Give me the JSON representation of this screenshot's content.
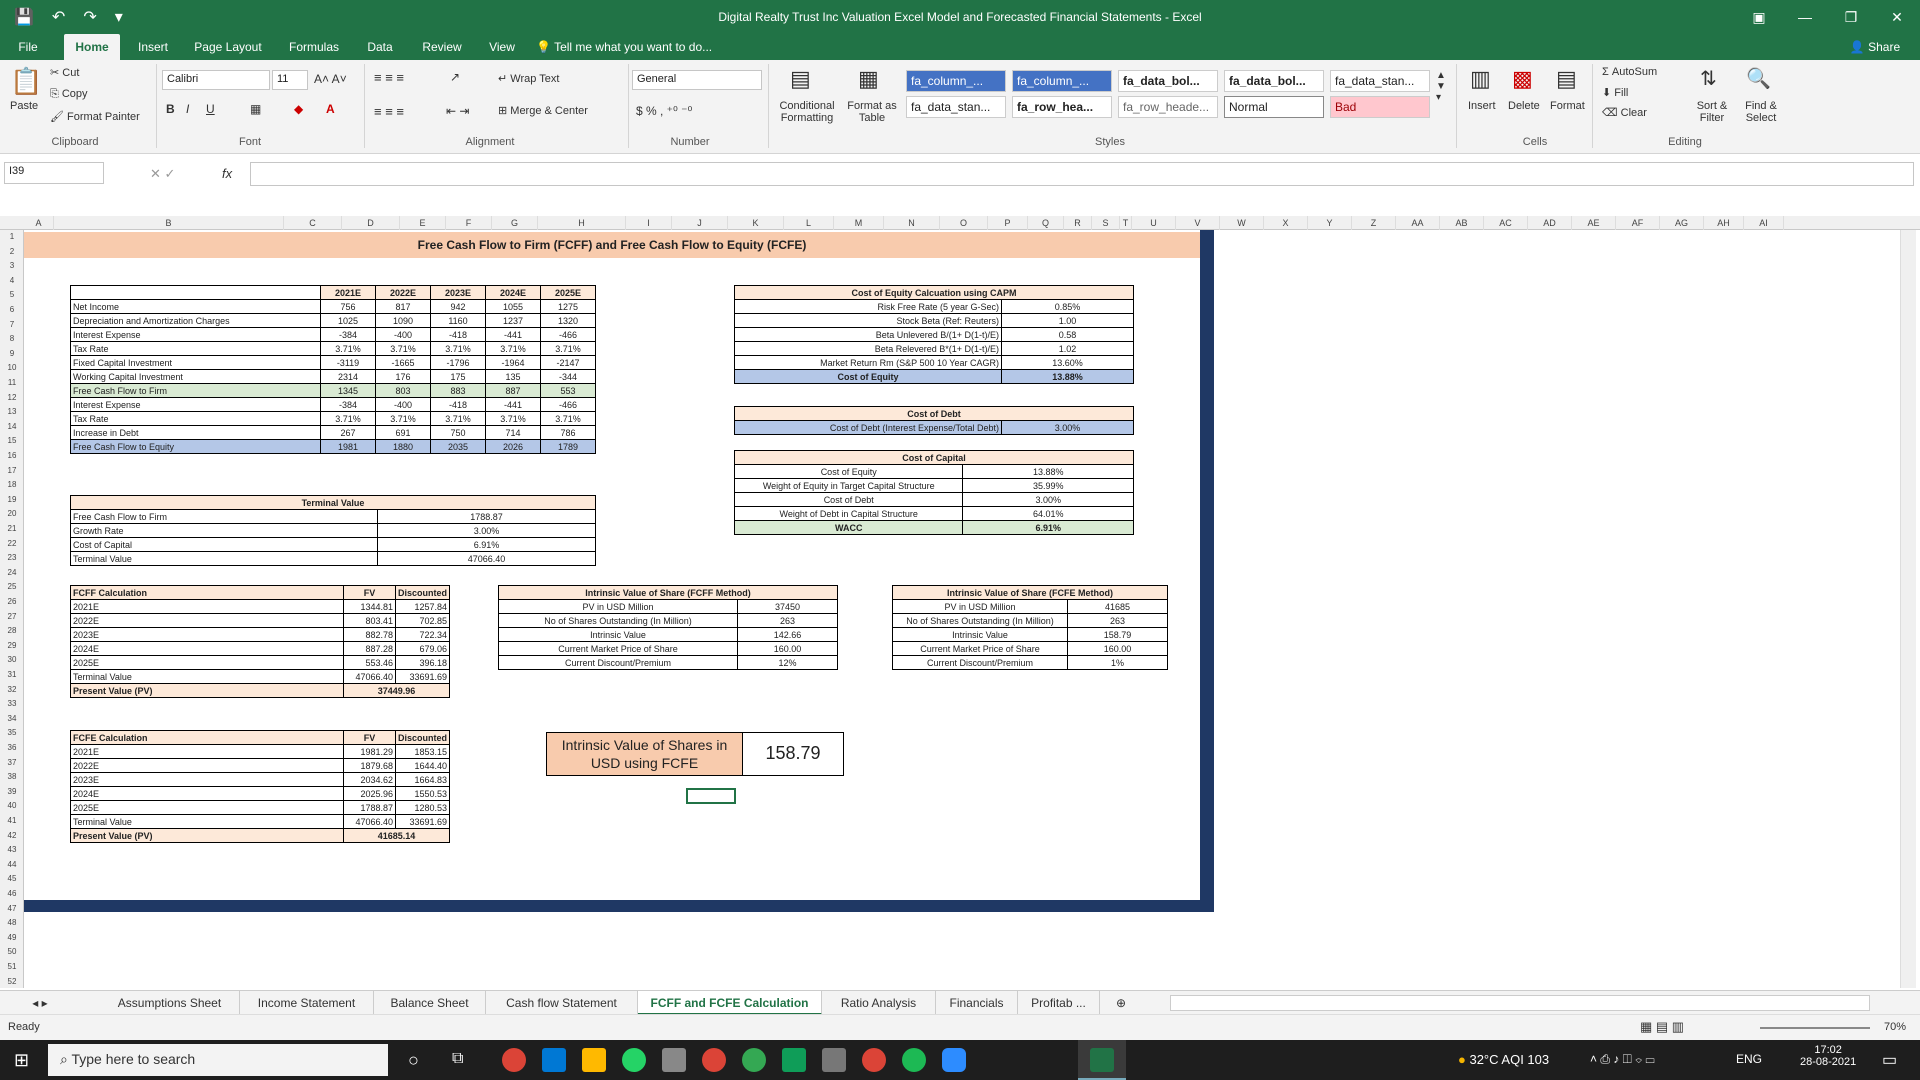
{
  "window": {
    "title": "Digital Realty Trust Inc Valuation Excel Model and Forecasted Financial Statements - Excel",
    "share": "Share"
  },
  "menu": {
    "tabs": [
      "File",
      "Home",
      "Insert",
      "Page Layout",
      "Formulas",
      "Data",
      "Review",
      "View"
    ],
    "tell": "Tell me what you want to do..."
  },
  "ribbon": {
    "clipboard": {
      "paste": "Paste",
      "cut": "Cut",
      "copy": "Copy",
      "painter": "Format Painter",
      "label": "Clipboard"
    },
    "font": {
      "name": "Calibri",
      "size": "11",
      "label": "Font"
    },
    "alignment": {
      "wrap": "Wrap Text",
      "merge": "Merge & Center",
      "label": "Alignment"
    },
    "number": {
      "format": "General",
      "label": "Number"
    },
    "styles": {
      "cond": "Conditional Formatting",
      "table": "Format as Table",
      "label": "Styles",
      "cells": [
        "fa_column_...",
        "fa_column_...",
        "fa_data_bol...",
        "fa_data_bol...",
        "fa_data_stan...",
        "fa_data_stan...",
        "fa_row_hea...",
        "fa_row_heade...",
        "Normal",
        "Bad"
      ]
    },
    "cells": {
      "insert": "Insert",
      "delete": "Delete",
      "format": "Format",
      "label": "Cells"
    },
    "editing": {
      "autosum": "AutoSum",
      "fill": "Fill",
      "clear": "Clear",
      "sort": "Sort & Filter",
      "find": "Find & Select",
      "label": "Editing"
    }
  },
  "formula": {
    "namebox": "I39",
    "fx": "fx",
    "value": ""
  },
  "columns": [
    "A",
    "B",
    "C",
    "D",
    "E",
    "F",
    "G",
    "H",
    "I",
    "J",
    "K",
    "L",
    "M",
    "N",
    "O",
    "P",
    "Q",
    "R",
    "S",
    "T",
    "U",
    "V",
    "W",
    "X",
    "Y",
    "Z",
    "AA",
    "AB",
    "AC",
    "AD",
    "AE",
    "AF",
    "AG",
    "AH",
    "AI"
  ],
  "rows": [
    "1",
    "2",
    "3",
    "4",
    "5",
    "6",
    "7",
    "8",
    "9",
    "10",
    "11",
    "12",
    "13",
    "14",
    "15",
    "16",
    "17",
    "18",
    "19",
    "20",
    "21",
    "22",
    "23",
    "24",
    "25",
    "26",
    "27",
    "28",
    "29",
    "30",
    "31",
    "32",
    "33",
    "34",
    "35",
    "36",
    "37",
    "38",
    "39",
    "40",
    "41",
    "42",
    "43",
    "44",
    "45",
    "46",
    "47",
    "48",
    "49",
    "50",
    "51",
    "52"
  ],
  "model": {
    "banner": "Free Cash Flow to Firm (FCFF) and Free Cash Flow to Equity (FCFE)",
    "fcf": {
      "headers": [
        "",
        "2021E",
        "2022E",
        "2023E",
        "2024E",
        "2025E"
      ],
      "rows": [
        [
          "Net Income",
          "756",
          "817",
          "942",
          "1055",
          "1275"
        ],
        [
          "Depreciation and Amortization Charges",
          "1025",
          "1090",
          "1160",
          "1237",
          "1320"
        ],
        [
          "Interest Expense",
          "-384",
          "-400",
          "-418",
          "-441",
          "-466"
        ],
        [
          "Tax Rate",
          "3.71%",
          "3.71%",
          "3.71%",
          "3.71%",
          "3.71%"
        ],
        [
          "Fixed Capital Investment",
          "-3119",
          "-1665",
          "-1796",
          "-1964",
          "-2147"
        ],
        [
          "Working Capital Investment",
          "2314",
          "176",
          "175",
          "135",
          "-344"
        ],
        [
          "Free Cash Flow to Firm",
          "1345",
          "803",
          "883",
          "887",
          "553"
        ],
        [
          "Interest Expense",
          "-384",
          "-400",
          "-418",
          "-441",
          "-466"
        ],
        [
          "Tax Rate",
          "3.71%",
          "3.71%",
          "3.71%",
          "3.71%",
          "3.71%"
        ],
        [
          "Increase in Debt",
          "267",
          "691",
          "750",
          "714",
          "786"
        ],
        [
          "Free Cash Flow to Equity",
          "1981",
          "1880",
          "2035",
          "2026",
          "1789"
        ]
      ]
    },
    "terminal": {
      "title": "Terminal Value",
      "rows": [
        [
          "Free Cash Flow to Firm",
          "1788.87"
        ],
        [
          "Growth Rate",
          "3.00%"
        ],
        [
          "Cost of Capital",
          "6.91%"
        ],
        [
          "Terminal Value",
          "47066.40"
        ]
      ]
    },
    "capm": {
      "title": "Cost of Equity Calcuation using CAPM",
      "rows": [
        [
          "Risk Free Rate (5 year G-Sec)",
          "0.85%"
        ],
        [
          "Stock Beta (Ref: Reuters)",
          "1.00"
        ],
        [
          "Beta Unlevered B/(1+ D(1-t)/E)",
          "0.58"
        ],
        [
          "Beta Relevered B*(1+ D(1-t)/E)",
          "1.02"
        ],
        [
          "Market Return Rm (S&P 500 10 Year CAGR)",
          "13.60%"
        ],
        [
          "Cost of Equity",
          "13.88%"
        ]
      ]
    },
    "debt": {
      "title": "Cost of Debt",
      "rows": [
        [
          "Cost of Debt (Interest Expense/Total Debt)",
          "3.00%"
        ]
      ]
    },
    "capital": {
      "title": "Cost of Capital",
      "rows": [
        [
          "Cost of Equity",
          "13.88%"
        ],
        [
          "Weight of Equity in Target Capital Structure",
          "35.99%"
        ],
        [
          "Cost of Debt",
          "3.00%"
        ],
        [
          "Weight of Debt in Capital Structure",
          "64.01%"
        ],
        [
          "WACC",
          "6.91%"
        ]
      ]
    },
    "fcff_calc": {
      "title": "FCFF Calculation",
      "h1": "FV",
      "h2": "Discounted",
      "rows": [
        [
          "2021E",
          "1344.81",
          "1257.84"
        ],
        [
          "2022E",
          "803.41",
          "702.85"
        ],
        [
          "2023E",
          "882.78",
          "722.34"
        ],
        [
          "2024E",
          "887.28",
          "679.06"
        ],
        [
          "2025E",
          "553.46",
          "396.18"
        ],
        [
          "Terminal Value",
          "47066.40",
          "33691.69"
        ]
      ],
      "pv_label": "Present Value (PV)",
      "pv": "37449.96"
    },
    "fcfe_calc": {
      "title": "FCFE Calculation",
      "h1": "FV",
      "h2": "Discounted",
      "rows": [
        [
          "2021E",
          "1981.29",
          "1853.15"
        ],
        [
          "2022E",
          "1879.68",
          "1644.40"
        ],
        [
          "2023E",
          "2034.62",
          "1664.83"
        ],
        [
          "2024E",
          "2025.96",
          "1550.53"
        ],
        [
          "2025E",
          "1788.87",
          "1280.53"
        ],
        [
          "Terminal Value",
          "47066.40",
          "33691.69"
        ]
      ],
      "pv_label": "Present Value (PV)",
      "pv": "41685.14"
    },
    "iv_fcff": {
      "title": "Intrinsic Value of Share (FCFF Method)",
      "rows": [
        [
          "PV in USD Million",
          "37450"
        ],
        [
          "No of Shares Outstanding (In Million)",
          "263"
        ],
        [
          "Intrinsic Value",
          "142.66"
        ],
        [
          "Current Market Price of Share",
          "160.00"
        ],
        [
          "Current Discount/Premium",
          "12%"
        ]
      ]
    },
    "iv_fcfe": {
      "title": "Intrinsic Value of Share (FCFE Method)",
      "rows": [
        [
          "PV in USD Million",
          "41685"
        ],
        [
          "No of Shares Outstanding (In Million)",
          "263"
        ],
        [
          "Intrinsic Value",
          "158.79"
        ],
        [
          "Current Market Price of Share",
          "160.00"
        ],
        [
          "Current Discount/Premium",
          "1%"
        ]
      ]
    },
    "result": {
      "label": "Intrinsic Value of Shares in USD using FCFE",
      "value": "158.79"
    }
  },
  "sheets": [
    "Assumptions Sheet",
    "Income Statement",
    "Balance Sheet",
    "Cash flow Statement",
    "FCFF and FCFE Calculation",
    "Ratio Analysis",
    "Financials",
    "Profitab ..."
  ],
  "status": {
    "ready": "Ready",
    "zoom": "70%"
  },
  "taskbar": {
    "search": "Type here to search",
    "weather": "32°C  AQI 103",
    "lang": "ENG",
    "time": "17:02",
    "date": "28-08-2021"
  }
}
